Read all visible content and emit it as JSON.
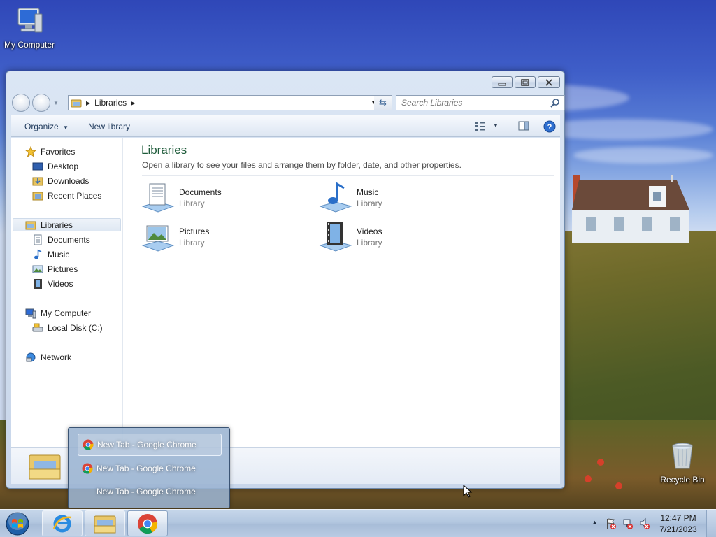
{
  "desktop": {
    "icons": [
      {
        "label": "My Computer",
        "icon": "computer-icon"
      },
      {
        "label": "Recycle Bin",
        "icon": "recycle-bin-icon"
      }
    ]
  },
  "window": {
    "caption_buttons": {
      "minimize": "minimize-icon",
      "maximize": "maximize-icon",
      "close": "close-icon"
    },
    "address": {
      "crumb": "Libraries"
    },
    "search": {
      "placeholder": "Search Libraries"
    },
    "toolbar": {
      "organize": "Organize",
      "new_library": "New library"
    },
    "nav": {
      "favorites": "Favorites",
      "desktop": "Desktop",
      "downloads": "Downloads",
      "recent_places": "Recent Places",
      "libraries": "Libraries",
      "documents": "Documents",
      "music": "Music",
      "pictures": "Pictures",
      "videos": "Videos",
      "my_computer": "My Computer",
      "local_disk": "Local Disk (C:)",
      "network": "Network"
    },
    "main": {
      "title": "Libraries",
      "subtitle": "Open a library to see your files and arrange them by folder, date, and other properties.",
      "libraries": [
        {
          "name": "Documents",
          "kind": "Library"
        },
        {
          "name": "Music",
          "kind": "Library"
        },
        {
          "name": "Pictures",
          "kind": "Library"
        },
        {
          "name": "Videos",
          "kind": "Library"
        }
      ]
    }
  },
  "popup": {
    "items": [
      {
        "label": "New Tab - Google Chrome",
        "active": true
      },
      {
        "label": "New Tab - Google Chrome",
        "active": false
      },
      {
        "label": "New Tab - Google Chrome",
        "active": false
      }
    ]
  },
  "taskbar": {
    "clock": {
      "time": "12:47 PM",
      "date": "7/21/2023"
    }
  },
  "colors": {
    "library_title": "#1e5b3a",
    "taskbar": "#b3c7e0",
    "link": "#1e395b"
  }
}
